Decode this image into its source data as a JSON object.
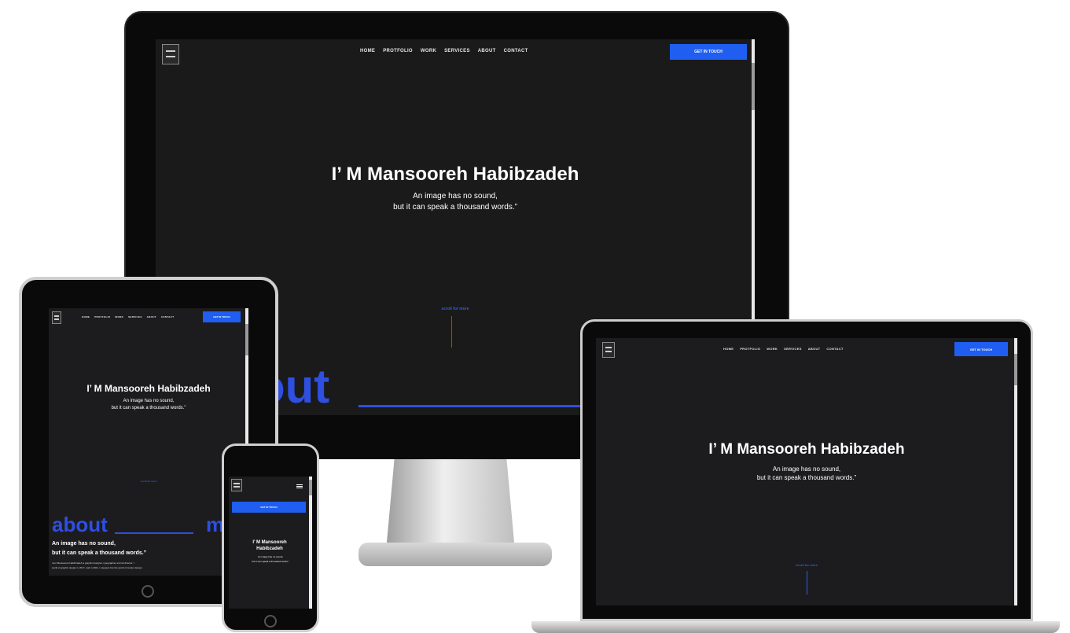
{
  "site": {
    "nav": [
      "HOME",
      "PROTFOLIO",
      "WORK",
      "SERVICES",
      "ABOUT",
      "CONTACT"
    ],
    "cta": "GET IN TOUCH",
    "hero_title": "I’ M Mansooreh Habibzadeh",
    "hero_line1": "An image has no sound,",
    "hero_line2": "but it can speak a thousand words.”",
    "scroll_label": "scroll for more",
    "about_word": "about",
    "about_word_tail": "out",
    "about_me_letter": "m",
    "about_heading_1": "An image has no sound,",
    "about_heading_2": "but it can speak a thousand words.”",
    "about_body_1": "I am Mansooreh Habibzadeh a graphic designer, typographer and art director. I ",
    "about_body_2": "world of graphic design in 2017, and in 2021, I stepped into the world of motion design"
  },
  "colors": {
    "accent": "#1f5ef0",
    "site_bg": "#1c1c1e",
    "bezel": "#0a0a0a",
    "text": "#ffffff"
  },
  "icons": {
    "menu": "hamburger-icon",
    "logo": "logo-mark",
    "home_button": "home-button-icon"
  }
}
